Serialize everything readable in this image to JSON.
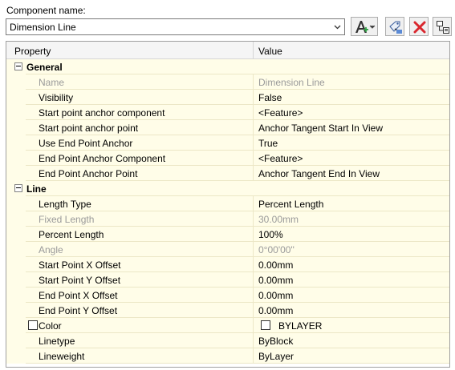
{
  "component_label": "Component name:",
  "component_combo": {
    "value": "Dimension Line"
  },
  "icons": {
    "add": "add-attribute-icon",
    "edit": "edit-attribute-icon",
    "delete": "delete-icon",
    "layout": "component-layout-icon",
    "accent_green": "#2ea043",
    "accent_red": "#d9272e"
  },
  "grid": {
    "header_property": "Property",
    "header_value": "Value",
    "sections": [
      {
        "title": "General",
        "rows": [
          {
            "property": "Name",
            "value": "Dimension Line",
            "disabled": true
          },
          {
            "property": "Visibility",
            "value": "False"
          },
          {
            "property": "Start point anchor component",
            "value": "<Feature>"
          },
          {
            "property": "Start point anchor point",
            "value": "Anchor Tangent Start In View"
          },
          {
            "property": "Use End Point Anchor",
            "value": "True"
          },
          {
            "property": "End Point Anchor Component",
            "value": "<Feature>"
          },
          {
            "property": "End Point Anchor Point",
            "value": "Anchor Tangent End In View"
          }
        ]
      },
      {
        "title": "Line",
        "rows": [
          {
            "property": "Length Type",
            "value": "Percent Length"
          },
          {
            "property": "Fixed Length",
            "value": "30.00mm",
            "disabled": true
          },
          {
            "property": "Percent Length",
            "value": "100%"
          },
          {
            "property": "Angle",
            "value": "0°00'00\"",
            "disabled": true
          },
          {
            "property": "Start Point X Offset",
            "value": "0.00mm"
          },
          {
            "property": "Start Point Y Offset",
            "value": "0.00mm"
          },
          {
            "property": "End Point X Offset",
            "value": "0.00mm"
          },
          {
            "property": "End Point Y Offset",
            "value": "0.00mm"
          },
          {
            "property": "Color",
            "value": "BYLAYER",
            "swatch": true
          },
          {
            "property": "Linetype",
            "value": "ByBlock"
          },
          {
            "property": "Lineweight",
            "value": "ByLayer"
          }
        ]
      }
    ]
  }
}
